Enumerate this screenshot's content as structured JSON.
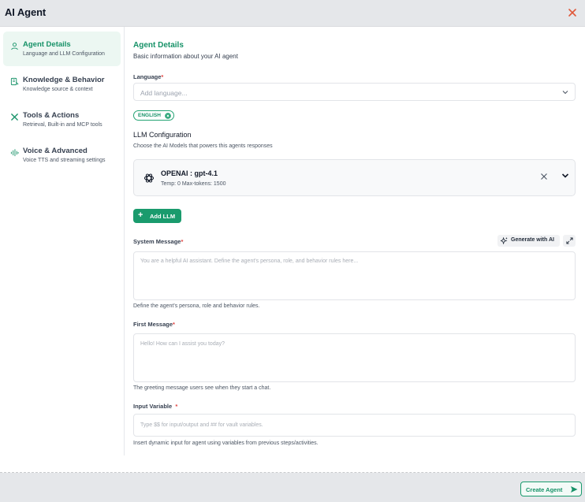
{
  "window": {
    "title": "AI Agent"
  },
  "sidebar": {
    "items": [
      {
        "title": "Agent Details",
        "subtitle": "Language and LLM Configuration",
        "icon": "user-icon"
      },
      {
        "title": "Knowledge & Behavior",
        "subtitle": "Knowledge source & context",
        "icon": "book-icon"
      },
      {
        "title": "Tools & Actions",
        "subtitle": "Retrieval, Built-in and MCP tools",
        "icon": "tools-icon"
      },
      {
        "title": "Voice & Advanced",
        "subtitle": "Voice TTS and streaming settings",
        "icon": "waveform-icon"
      }
    ]
  },
  "main": {
    "title": "Agent Details",
    "subtitle": "Basic information about your AI agent",
    "language": {
      "label": "Language",
      "required_mark": "*",
      "placeholder": "Add language...",
      "selected_chip": "ENGLISH"
    },
    "llm": {
      "label": "LLM Configuration",
      "hint": "Choose the AI Models that powers this agents responses",
      "card": {
        "name": "OPENAI : gpt-4.1",
        "meta": "Temp: 0   Max-tokens: 1500"
      },
      "add_button": "Add LLM"
    },
    "system_message": {
      "label": "System Message",
      "required_mark": "*",
      "generate_button": "Generate with AI",
      "placeholder": "You are a helpful AI assistant. Define the agent's persona, role, and behavior rules here...",
      "hint": "Define the agent's persona, role and behavior rules."
    },
    "first_message": {
      "label": "First Message",
      "required_mark": "*",
      "placeholder": "Hello! How can I assist you today?",
      "hint": "The greeting message users see when they start a chat."
    },
    "input_variable": {
      "label": "Input Variable",
      "required_mark": "*",
      "placeholder": "Type $$ for input/output and ## for vault variables.",
      "hint": "Insert dynamic input for agent using variables from previous steps/activities."
    }
  },
  "footer": {
    "create_button": "Create Agent"
  },
  "colors": {
    "accent": "#179268",
    "required": "#e0423f",
    "close": "#e0583a"
  }
}
